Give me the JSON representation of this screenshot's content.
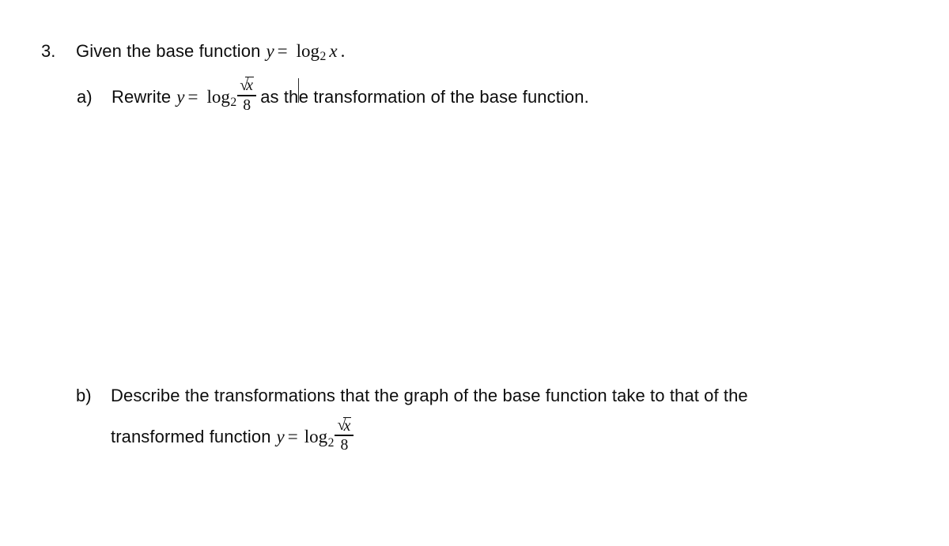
{
  "document": {
    "background_color": "#ffffff",
    "text_color": "#0d0d0d",
    "caret_color": "#2b2b2b"
  },
  "question": {
    "number": "3.",
    "stem": {
      "lead_text": "Given the  base function",
      "equation": {
        "lhs": "y",
        "relation": "=",
        "operator": "log",
        "subscript": "2",
        "argument": "x"
      },
      "trailing_text": "."
    },
    "parts": [
      {
        "marker": "a)",
        "text_before": "Rewrite",
        "equation": {
          "lhs": "y",
          "relation": "=",
          "operator": "log",
          "subscript": "2",
          "fraction": {
            "numerator_radical": "√",
            "numerator_radicand": "x",
            "denominator": "8"
          }
        },
        "text_after_1": "as th",
        "caret": true,
        "text_after_2": "e transformation of the base function."
      },
      {
        "marker": "b)",
        "line1": "Describe the transformations that the graph of the base function take to that of the",
        "line2_text": "transformed function",
        "line2_equation": {
          "lhs": "y",
          "relation": "=",
          "operator": "log",
          "subscript": "2",
          "fraction": {
            "numerator_radical": "√",
            "numerator_radicand": "x",
            "denominator": "8"
          }
        }
      }
    ]
  }
}
